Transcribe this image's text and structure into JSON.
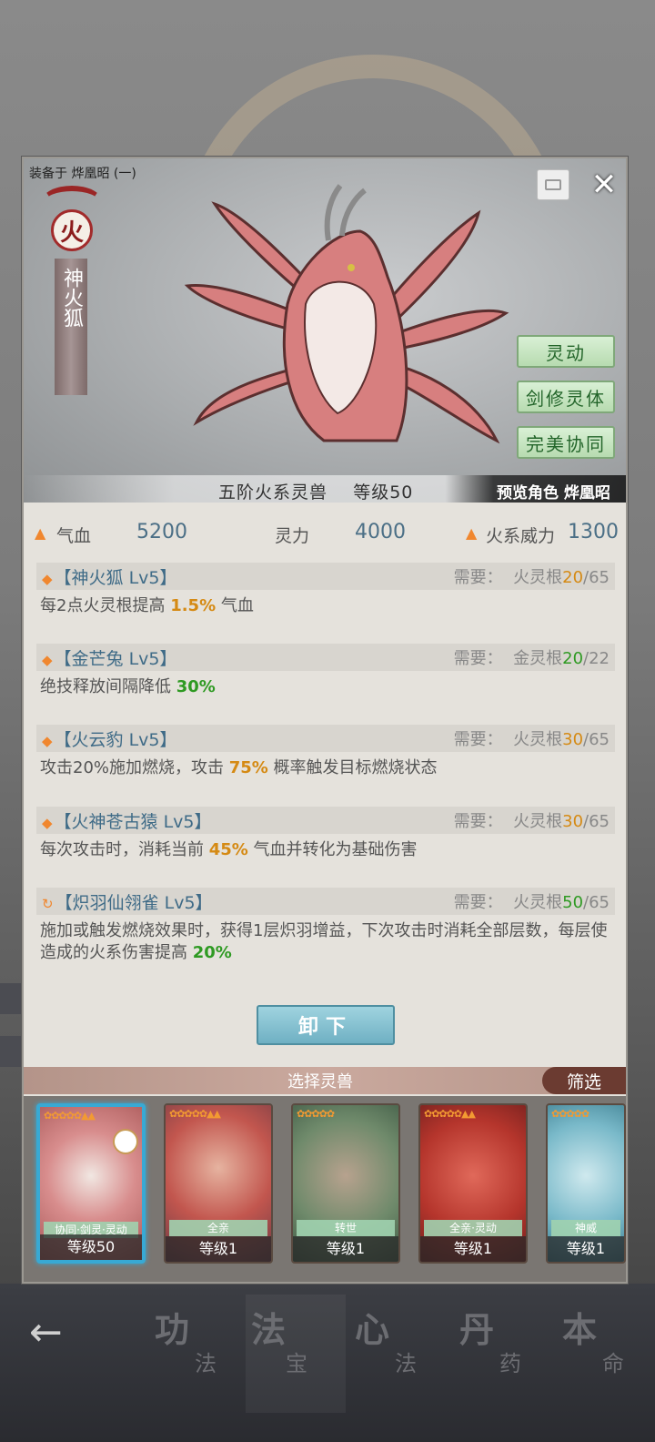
{
  "panel": {
    "equipped_on": "装备于 烨凰昭 (一)",
    "element_badge": "火",
    "beast_name": "神火狐",
    "tags": [
      "灵动",
      "剑修灵体",
      "完美协同"
    ],
    "rank_text": "五阶火系灵兽",
    "level_text": "等级50",
    "preview_text": "预览角色 烨凰昭"
  },
  "stats": [
    {
      "label": "气血",
      "value": "5200"
    },
    {
      "label": "灵力",
      "value": "4000"
    },
    {
      "label": "火系威力",
      "value": "1300"
    }
  ],
  "skills": [
    {
      "name": "【神火狐 Lv5】",
      "req_label": "需要：",
      "req_type": "火灵根",
      "req_cur": "20",
      "req_max": "/65",
      "desc_pre": "每2点火灵根提高 ",
      "desc_hl": "1.5%",
      "desc_post": " 气血"
    },
    {
      "name": "【金芒兔 Lv5】",
      "req_label": "需要：",
      "req_type": "金灵根",
      "req_cur": "20",
      "req_max": "/22",
      "desc_pre": "绝技释放间隔降低 ",
      "desc_hl": "30%",
      "desc_post": ""
    },
    {
      "name": "【火云豹 Lv5】",
      "req_label": "需要：",
      "req_type": "火灵根",
      "req_cur": "30",
      "req_max": "/65",
      "desc_pre": "攻击20%施加燃烧，攻击 ",
      "desc_hl": "75%",
      "desc_post": " 概率触发目标燃烧状态"
    },
    {
      "name": "【火神苍古猿 Lv5】",
      "req_label": "需要：",
      "req_type": "火灵根",
      "req_cur": "30",
      "req_max": "/65",
      "desc_pre": "每次攻击时，消耗当前 ",
      "desc_hl": "45%",
      "desc_post": " 气血并转化为基础伤害"
    },
    {
      "name": "【炽羽仙翎雀 Lv5】",
      "req_label": "需要：",
      "req_type": "火灵根",
      "req_cur": "50",
      "req_max": "/65",
      "desc_pre": "施加或触发燃烧效果时，获得1层炽羽增益，下次攻击时消耗全部层数，每层使造成的火系伤害提高 ",
      "desc_hl": "20%",
      "desc_post": ""
    }
  ],
  "unequip_label": "卸下",
  "select_title": "选择灵兽",
  "filter_label": "筛选",
  "cards": [
    {
      "trait": "协同·剑灵·灵动",
      "level": "等级50"
    },
    {
      "trait": "全亲",
      "level": "等级1"
    },
    {
      "trait": "转世",
      "level": "等级1"
    },
    {
      "trait": "全亲·灵动",
      "level": "等级1"
    },
    {
      "trait": "神威",
      "level": "等级1"
    }
  ],
  "nav": [
    {
      "big": "功",
      "small": "法"
    },
    {
      "big": "法",
      "small": "宝"
    },
    {
      "big": "心",
      "small": "法"
    },
    {
      "big": "丹",
      "small": "药"
    },
    {
      "big": "本",
      "small": "命"
    }
  ],
  "colors": {
    "accent_orange": "#d58a14",
    "accent_green": "#2f9a23",
    "select_border": "#38a9d4"
  }
}
